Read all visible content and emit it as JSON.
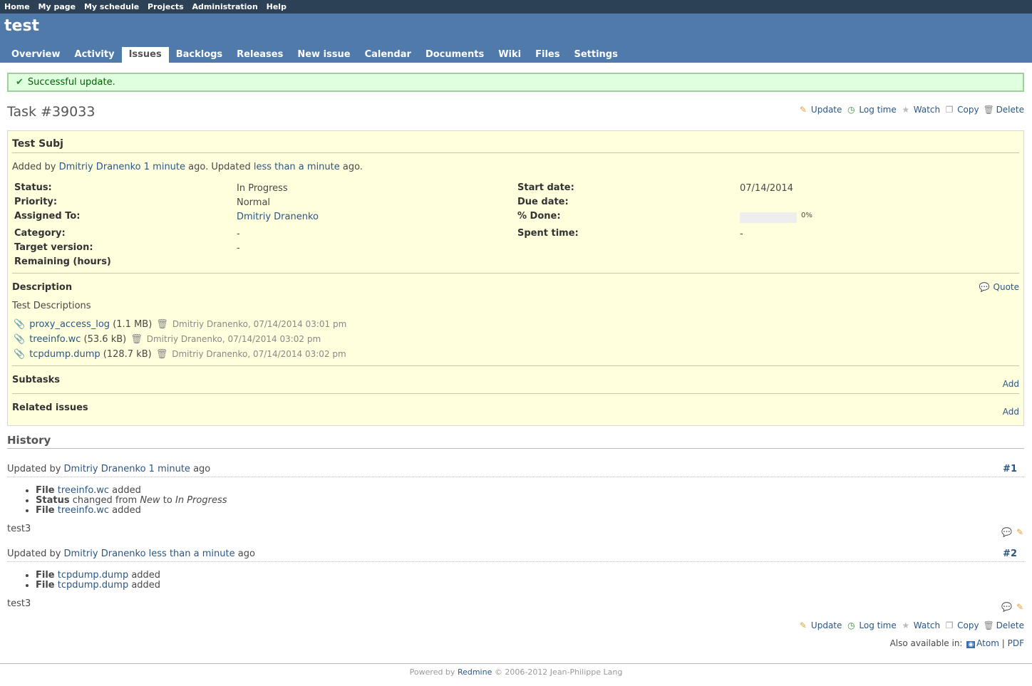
{
  "top_menu": [
    "Home",
    "My page",
    "My schedule",
    "Projects",
    "Administration",
    "Help"
  ],
  "project": "test",
  "tabs": [
    "Overview",
    "Activity",
    "Issues",
    "Backlogs",
    "Releases",
    "New issue",
    "Calendar",
    "Documents",
    "Wiki",
    "Files",
    "Settings"
  ],
  "selected_tab": "Issues",
  "flash": "Successful update.",
  "issue": {
    "title": "Task #39033",
    "actions": {
      "update": "Update",
      "log_time": "Log time",
      "watch": "Watch",
      "copy": "Copy",
      "delete": "Delete"
    },
    "subject": "Test Subj",
    "author_line": {
      "prefix": "Added by ",
      "author": "Dmitriy Dranenko",
      "created": "1 minute",
      "mid": " ago. Updated ",
      "updated": "less than a minute",
      "suffix": " ago."
    },
    "attrs_left": [
      {
        "label": "Status:",
        "value": "In Progress"
      },
      {
        "label": "Priority:",
        "value": "Normal"
      },
      {
        "label": "Assigned To:",
        "value": "Dmitriy Dranenko"
      },
      {
        "label": "Category:",
        "value": "-"
      },
      {
        "label": "Target version:",
        "value": "-"
      },
      {
        "label": "Remaining (hours)",
        "value": ""
      }
    ],
    "attrs_right": [
      {
        "label": "Start date:",
        "value": "07/14/2014"
      },
      {
        "label": "Due date:",
        "value": ""
      },
      {
        "label": "% Done:",
        "value": "0%"
      },
      {
        "label": "Spent time:",
        "value": "-"
      }
    ],
    "done_ratio": 0,
    "description_label": "Description",
    "quote": "Quote",
    "description": "Test Descriptions",
    "attachments": [
      {
        "name": "proxy_access_log",
        "size": "(1.1 MB)",
        "meta": "Dmitriy Dranenko, 07/14/2014 03:01 pm"
      },
      {
        "name": "treeinfo.wc",
        "size": "(53.6 kB)",
        "meta": "Dmitriy Dranenko, 07/14/2014 03:02 pm"
      },
      {
        "name": "tcpdump.dump",
        "size": "(128.7 kB)",
        "meta": "Dmitriy Dranenko, 07/14/2014 03:02 pm"
      }
    ],
    "subtasks_label": "Subtasks",
    "related_label": "Related issues",
    "add": "Add"
  },
  "history": {
    "title": "History",
    "journals": [
      {
        "prefix": "Updated by ",
        "author": "Dmitriy Dranenko",
        "time": "1 minute",
        "suffix": " ago",
        "num": "#1",
        "notes": "test3"
      },
      {
        "prefix": "Updated by ",
        "author": "Dmitriy Dranenko",
        "time": "less than a minute",
        "suffix": " ago",
        "num": "#2",
        "notes": "test3"
      }
    ],
    "j1": {
      "d1": {
        "label": "File",
        "link": "treeinfo.wc",
        "rest": " added"
      },
      "d2": {
        "label": "Status",
        "pre": " changed from ",
        "from": "New",
        "mid": " to ",
        "to": "In Progress"
      },
      "d3": {
        "label": "File",
        "link": "treeinfo.wc",
        "rest": " added"
      }
    },
    "j2": {
      "d1": {
        "label": "File",
        "link": "tcpdump.dump",
        "rest": " added"
      },
      "d2": {
        "label": "File",
        "link": "tcpdump.dump",
        "rest": " added"
      }
    }
  },
  "other_formats": {
    "label": "Also available in:",
    "atom": "Atom",
    "sep": "|",
    "pdf": "PDF"
  },
  "footer": {
    "prefix": "Powered by ",
    "link": "Redmine",
    "suffix": " © 2006-2012 Jean-Philippe Lang"
  }
}
